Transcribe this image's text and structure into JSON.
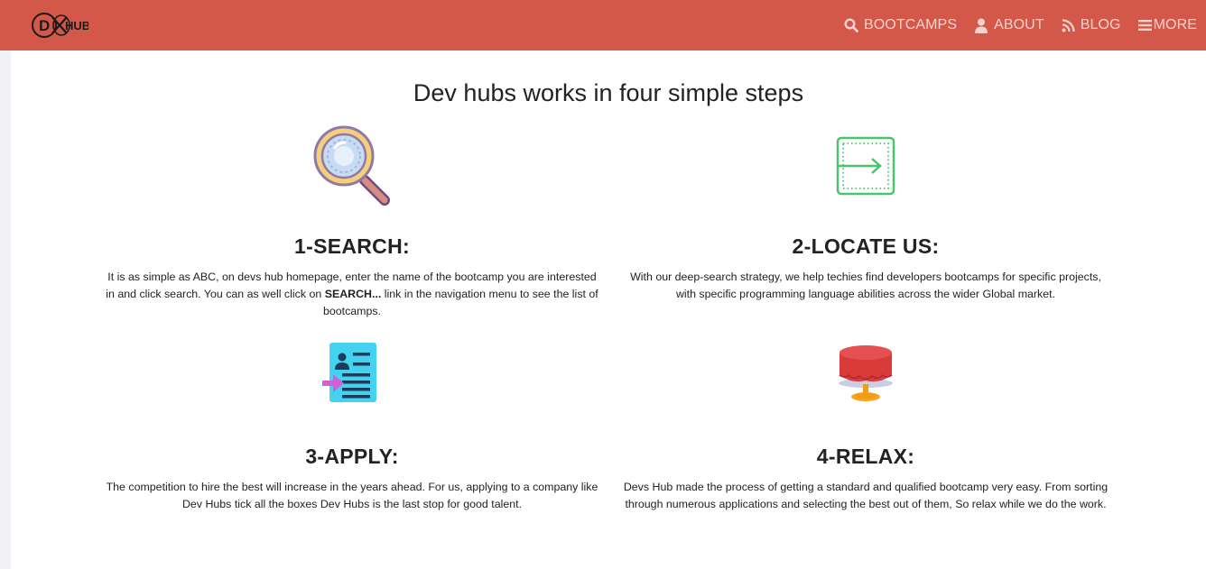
{
  "nav": {
    "logo_text": "DXHUB",
    "links": [
      {
        "label": "BOOTCAMPS",
        "icon": "search-icon"
      },
      {
        "label": "ABOUT",
        "icon": "user-icon"
      },
      {
        "label": "BLOG",
        "icon": "rss-icon"
      },
      {
        "label": "MORE",
        "icon": "menu-icon"
      }
    ],
    "colors": {
      "bar": "#d3584a",
      "link": "#f6d2cc"
    }
  },
  "main": {
    "heading": "Dev hubs works in four simple steps",
    "steps": [
      {
        "title": "1-SEARCH:",
        "icon": "magnifier-icon",
        "text_before": "It is as simple as ABC, on devs hub homepage, enter the name of the bootcamp you are interested in and click search. You can as well click on ",
        "text_bold": "SEARCH...",
        "text_after": " link in the navigation menu to see the list of bootcamps."
      },
      {
        "title": "2-LOCATE US:",
        "icon": "enter-arrow-icon",
        "text": "With our deep-search strategy, we help techies find developers bootcamps for specific projects, with specific programming language abilities across the wider Global market."
      },
      {
        "title": "3-APPLY:",
        "icon": "application-form-icon",
        "text": "The competition to hire the best will increase in the years ahead. For us, applying to a company like Dev Hubs tick all the boxes Dev Hubs is the last stop for good talent."
      },
      {
        "title": "4-RELAX:",
        "icon": "table-icon",
        "text": "Devs Hub made the process of getting a standard and qualified bootcamp very easy. From sorting through numerous applications and selecting the best out of them, So relax while we do the work."
      }
    ]
  }
}
